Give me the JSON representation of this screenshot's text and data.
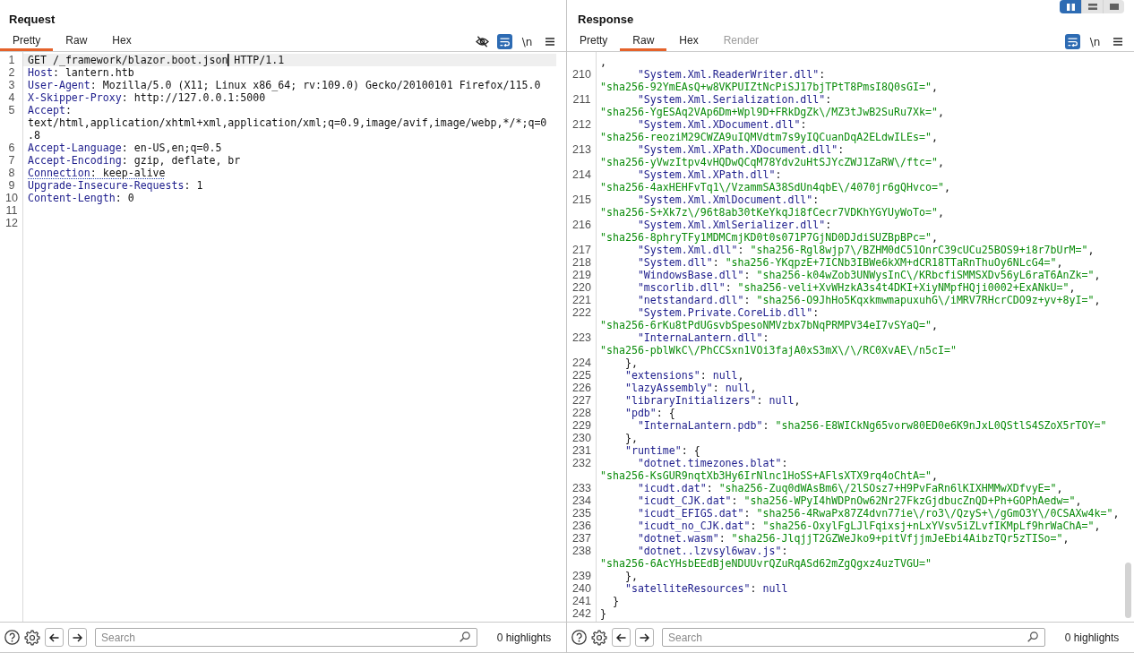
{
  "layout_buttons": [
    {
      "selected": true
    },
    {
      "selected": false
    },
    {
      "selected": false
    }
  ],
  "request": {
    "title": "Request",
    "tabs": [
      {
        "label": "Pretty",
        "selected": true,
        "disabled": false
      },
      {
        "label": "Raw",
        "selected": false,
        "disabled": false
      },
      {
        "label": "Hex",
        "selected": false,
        "disabled": false
      }
    ],
    "toolbar": [
      {
        "kind": "visibility",
        "on": false
      },
      {
        "kind": "wrap",
        "on": true
      },
      {
        "kind": "newlines",
        "label": "\\n",
        "on": false
      },
      {
        "kind": "menu",
        "on": false
      }
    ],
    "lines": [
      {
        "number": "1",
        "text": "GET /_framework/blazor.boot.json",
        "after_cursor": " HTTP/1.1",
        "current": true,
        "underlined": false
      },
      {
        "number": "2",
        "text": "Host: lantern.htb",
        "current": false,
        "underlined": false
      },
      {
        "number": "3",
        "text": "User-Agent: Mozilla/5.0 (X11; Linux x86_64; rv:109.0) Gecko/20100101 Firefox/115.0",
        "current": false,
        "underlined": false
      },
      {
        "number": "4",
        "text": "X-Skipper-Proxy: http://127.0.0.1:5000",
        "current": false,
        "underlined": false
      },
      {
        "number": "5",
        "text": "Accept: text/html,application/xhtml+xml,application/xml;q=0.9,image/avif,image/webp,*/*;q=0.8",
        "current": false,
        "underlined": false
      },
      {
        "number": "6",
        "text": "Accept-Language: en-US,en;q=0.5",
        "current": false,
        "underlined": false
      },
      {
        "number": "7",
        "text": "Accept-Encoding: gzip, deflate, br",
        "current": false,
        "underlined": false
      },
      {
        "number": "8",
        "text": "Connection: keep-alive",
        "current": false,
        "underlined": true
      },
      {
        "number": "9",
        "text": "Upgrade-Insecure-Requests: 1",
        "current": false,
        "underlined": false
      },
      {
        "number": "10",
        "text": "Content-Length: 0",
        "current": false,
        "underlined": false
      },
      {
        "number": "11",
        "current": false,
        "underlined": false
      },
      {
        "number": "12",
        "current": false,
        "underlined": false
      }
    ],
    "footer": {
      "search": {
        "placeholder": "Search"
      },
      "highlights": "0 highlights"
    }
  },
  "response": {
    "title": "Response",
    "tabs": [
      {
        "label": "Pretty",
        "selected": false,
        "disabled": false
      },
      {
        "label": "Raw",
        "selected": true,
        "disabled": false
      },
      {
        "label": "Hex",
        "selected": false,
        "disabled": false
      },
      {
        "label": "Render",
        "selected": false,
        "disabled": true
      }
    ],
    "toolbar": [
      {
        "kind": "wrap",
        "on": true
      },
      {
        "kind": "newlines",
        "label": "\\n",
        "on": false
      },
      {
        "kind": "menu",
        "on": false
      }
    ],
    "scrolled_line_tail": ",",
    "lines": [
      {
        "number": "210",
        "text": "      \"System.Xml.ReaderWriter.dll\": \"sha256-92YmEAsQ+w8VKPUIZtNcPiSJ17bjTPtT8PmsI8Q0sGI=\","
      },
      {
        "number": "211",
        "text": "      \"System.Xml.Serialization.dll\": \"sha256-YgESAq2VAp6Dm+Wpl9D+FRkDgZk\\/MZ3tJwB2SuRu7Xk=\","
      },
      {
        "number": "212",
        "text": "      \"System.Xml.XDocument.dll\": \"sha256-reoziM29CWZA9uIQMVdtm7s9yIQCuanDqA2ELdwILEs=\","
      },
      {
        "number": "213",
        "text": "      \"System.Xml.XPath.XDocument.dll\": \"sha256-yVwzItpv4vHQDwQCqM78Ydv2uHtSJYcZWJ1ZaRW\\/ftc=\","
      },
      {
        "number": "214",
        "text": "      \"System.Xml.XPath.dll\": \"sha256-4axHEHFvTq1\\/VzammSA38SdUn4qbE\\/4070jr6gQHvco=\","
      },
      {
        "number": "215",
        "text": "      \"System.Xml.XmlDocument.dll\": \"sha256-S+Xk7z\\/96t8ab30tKeYkqJi8fCecr7VDKhYGYUyWoTo=\","
      },
      {
        "number": "216",
        "text": "      \"System.Xml.XmlSerializer.dll\": \"sha256-8phryTFy1MDMCmjKD0t0s071P7GjND0DJdiSUZBpBPc=\","
      },
      {
        "number": "217",
        "text": "      \"System.Xml.dll\": \"sha256-Rgl8wjp7\\/BZHM0dC51OnrC39cUCu25BOS9+i8r7bUrM=\","
      },
      {
        "number": "218",
        "text": "      \"System.dll\": \"sha256-YKqpzE+7ICNb3IBWe6kXM+dCR18TTaRnThuOy6NLcG4=\","
      },
      {
        "number": "219",
        "text": "      \"WindowsBase.dll\": \"sha256-k04wZob3UNWysInC\\/KRbcfiSMMSXDv56yL6raT6AnZk=\","
      },
      {
        "number": "220",
        "text": "      \"mscorlib.dll\": \"sha256-veli+XvWHzkA3s4t4DKI+XiyNMpfHQji0002+ExANkU=\","
      },
      {
        "number": "221",
        "text": "      \"netstandard.dll\": \"sha256-O9JhHo5KqxkmwmapuxuhG\\/iMRV7RHcrCDO9z+yv+8yI=\","
      },
      {
        "number": "222",
        "text": "      \"System.Private.CoreLib.dll\": \"sha256-6rKu8tPdUGsvbSpesoNMVzbx7bNqPRMPV34eI7vSYaQ=\","
      },
      {
        "number": "223",
        "text": "      \"InternaLantern.dll\": \"sha256-pblWkC\\/PhCCSxn1VOi3fajA0xS3mX\\/\\/RC0XvAE\\/n5cI=\""
      },
      {
        "number": "224",
        "text": "    },"
      },
      {
        "number": "225",
        "text": "    \"extensions\": null,"
      },
      {
        "number": "226",
        "text": "    \"lazyAssembly\": null,"
      },
      {
        "number": "227",
        "text": "    \"libraryInitializers\": null,"
      },
      {
        "number": "228",
        "text": "    \"pdb\": {"
      },
      {
        "number": "229",
        "text": "      \"InternaLantern.pdb\": \"sha256-E8WICkNg65vorw80ED0e6K9nJxL0QStlS4SZoX5rTOY=\""
      },
      {
        "number": "230",
        "text": "    },"
      },
      {
        "number": "231",
        "text": "    \"runtime\": {"
      },
      {
        "number": "232",
        "text": "      \"dotnet.timezones.blat\": \"sha256-KsGUR9nqtXb3Hy6IrNlnc1HoSS+AFlsXTX9rq4oChtA=\","
      },
      {
        "number": "233",
        "text": "      \"icudt.dat\": \"sha256-Zuq0dWAsBm6\\/2lSOsz7+H9PvFaRn6lKIXHMMwXDfvyE=\","
      },
      {
        "number": "234",
        "text": "      \"icudt_CJK.dat\": \"sha256-WPyI4hWDPnOw62Nr27FkzGjdbucZnQD+Ph+GOPhAedw=\","
      },
      {
        "number": "235",
        "text": "      \"icudt_EFIGS.dat\": \"sha256-4RwaPx87Z4dvn77ie\\/ro3\\/QzyS+\\/gGmO3Y\\/0CSAXw4k=\","
      },
      {
        "number": "236",
        "text": "      \"icudt_no_CJK.dat\": \"sha256-OxylFgLJlFqixsj+nLxYVsv5iZLvfIKMpLf9hrWaChA=\","
      },
      {
        "number": "237",
        "text": "      \"dotnet.wasm\": \"sha256-JlqjjT2GZWeJko9+pitVfjjmJeEbi4AibzTQr5zTISo=\","
      },
      {
        "number": "238",
        "text": "      \"dotnet..lzvsyl6wav.js\": \"sha256-6AcYHsbEEdBjeNDUUvrQZuRqASd62mZgQgxz4uzTVGU=\""
      },
      {
        "number": "239",
        "text": "    },"
      },
      {
        "number": "240",
        "text": "    \"satelliteResources\": null"
      },
      {
        "number": "241",
        "text": "  }"
      },
      {
        "number": "242",
        "text": "}"
      }
    ],
    "footer": {
      "search": {
        "placeholder": "Search"
      },
      "highlights": "0 highlights"
    }
  }
}
